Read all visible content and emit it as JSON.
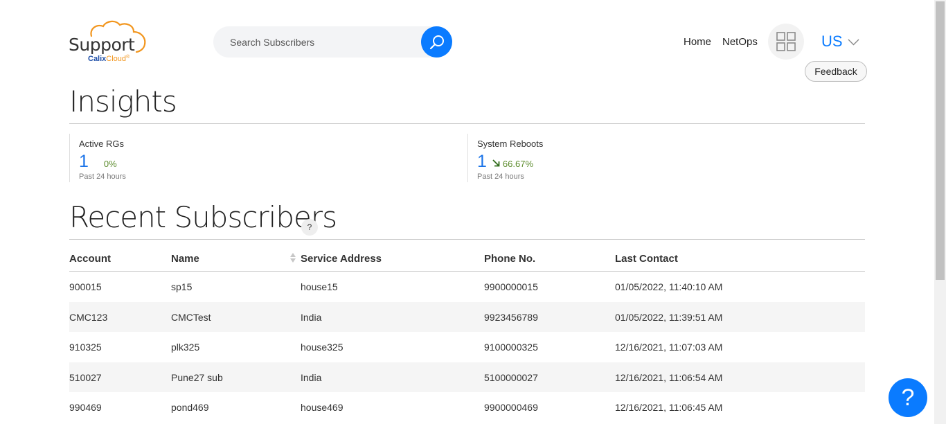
{
  "header": {
    "logo_main": "Support",
    "logo_calix": "Calix",
    "logo_cloud": "Cloud",
    "logo_reg": "®",
    "search_placeholder": "Search Subscribers",
    "search_icon": "search-icon",
    "nav": {
      "home": "Home",
      "netops": "NetOps"
    },
    "apps_icon": "grid-icon",
    "region": "US",
    "region_icon": "chevron-down-icon",
    "feedback": "Feedback"
  },
  "insights": {
    "title": "Insights",
    "metrics": [
      {
        "label": "Active RGs",
        "value": "1",
        "percent": "0%",
        "sub": "Past 24 hours"
      },
      {
        "label": "System Reboots",
        "value": "1",
        "percent": "66.67%",
        "trend": "arrow-down-right-icon",
        "sub": "Past 24 hours"
      }
    ]
  },
  "recent": {
    "title": "Recent Subscribers",
    "help": "?",
    "columns": [
      "Account",
      "Name",
      "Service Address",
      "Phone No.",
      "Last Contact"
    ],
    "rows": [
      [
        "900015",
        "sp15",
        "house15",
        "9900000015",
        "01/05/2022, 11:40:10 AM"
      ],
      [
        "CMC123",
        "CMCTest",
        "India",
        "9923456789",
        "01/05/2022, 11:39:51 AM"
      ],
      [
        "910325",
        "plk325",
        "house325",
        "9100000325",
        "12/16/2021, 11:07:03 AM"
      ],
      [
        "510027",
        "Pune27 sub",
        "India",
        "5100000027",
        "12/16/2021, 11:06:54 AM"
      ],
      [
        "990469",
        "pond469",
        "house469",
        "9900000469",
        "12/16/2021, 11:06:45 AM"
      ]
    ]
  },
  "help_fab": "?",
  "colors": {
    "accent": "#0a7bff",
    "brand_orange": "#f2961e",
    "brand_blue": "#1f4fa8",
    "trend_green": "#5a8a2a"
  }
}
